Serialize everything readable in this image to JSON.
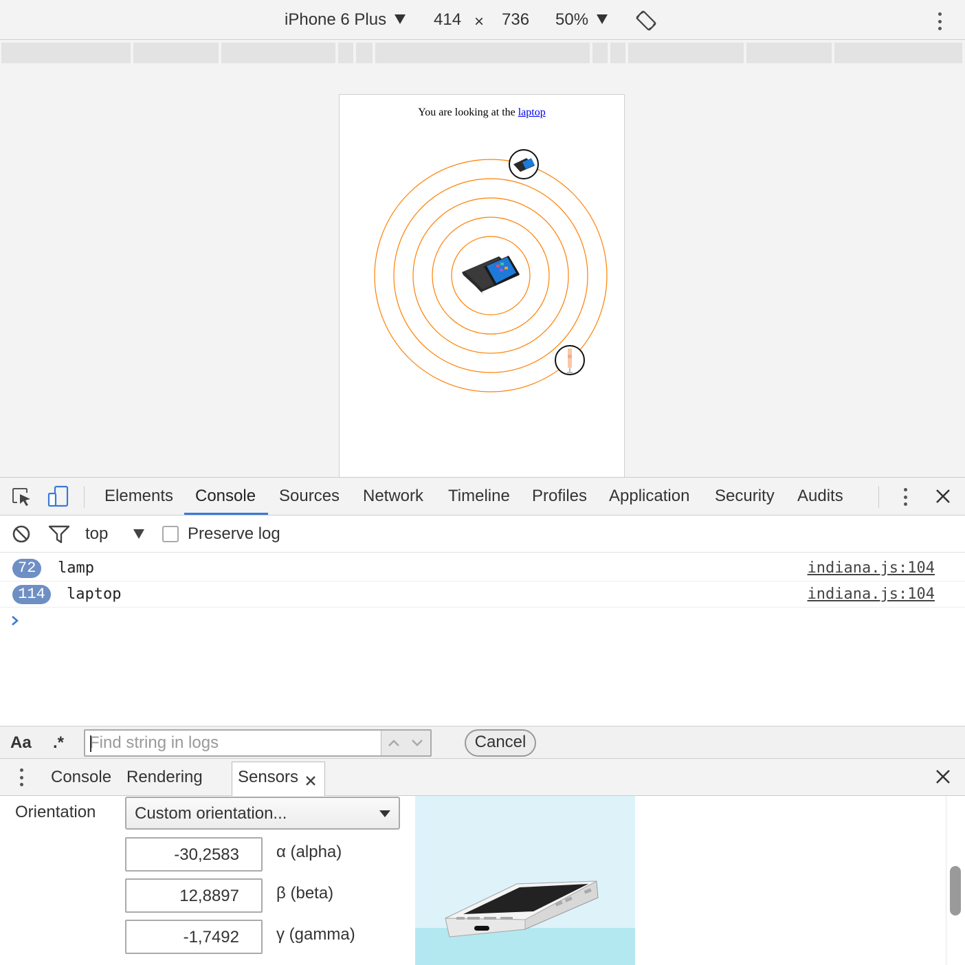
{
  "device_toolbar": {
    "device_name": "iPhone 6 Plus",
    "width": "414",
    "times": "×",
    "height": "736",
    "zoom": "50%"
  },
  "page": {
    "heading_prefix": "You are looking at the ",
    "heading_link": "laptop"
  },
  "devtools": {
    "tabs": [
      "Elements",
      "Console",
      "Sources",
      "Network",
      "Timeline",
      "Profiles",
      "Application",
      "Security",
      "Audits"
    ],
    "active_tab": "Console"
  },
  "console_toolbar": {
    "context": "top",
    "preserve_log_label": "Preserve log",
    "preserve_log_checked": false
  },
  "console_messages": [
    {
      "count": "72",
      "text": "lamp",
      "source": "indiana.js:104"
    },
    {
      "count": "114",
      "text": "laptop",
      "source": "indiana.js:104"
    }
  ],
  "search_bar": {
    "match_case_label": "Aa",
    "regex_label": ".*",
    "placeholder": "Find string in logs",
    "cancel_label": "Cancel"
  },
  "drawer": {
    "tabs": [
      "Console",
      "Rendering",
      "Sensors"
    ],
    "active_tab": "Sensors"
  },
  "sensors": {
    "orientation_label": "Orientation",
    "orientation_select": "Custom orientation...",
    "alpha_value": "-30,2583",
    "alpha_label": "α (alpha)",
    "beta_value": "12,8897",
    "beta_label": "β (beta)",
    "gamma_value": "-1,7492",
    "gamma_label": "γ (gamma)"
  },
  "colors": {
    "accent": "#3879d9",
    "ring": "#ff7f00",
    "badge": "#6e8fc4"
  }
}
